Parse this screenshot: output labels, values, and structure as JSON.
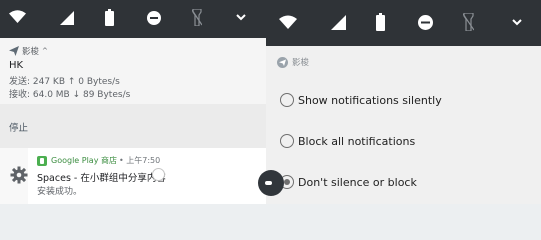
{
  "left_notification": {
    "app_name": "影梭",
    "expand_glyph": "^",
    "title": "HK",
    "send_line": "发送: 247 KB ↑ 0 Bytes/s",
    "recv_line": "接收: 64.0 MB ↓ 89 Bytes/s",
    "stop_action": "停止"
  },
  "play_notification": {
    "app_name": "Google Play 商店",
    "time": "• 上午7:50",
    "title": "Spaces - 在小群组中分享内容",
    "text": "安装成功。"
  },
  "right_panel": {
    "app_name": "影梭",
    "options": [
      {
        "label": "Show notifications silently",
        "selected": false
      },
      {
        "label": "Block all notifications",
        "selected": false
      },
      {
        "label": "Don't silence or block",
        "selected": true
      }
    ]
  },
  "icons": {
    "status_bar": [
      "wifi-icon",
      "signal-icon",
      "battery-icon",
      "dnd-icon",
      "flashlight-off-icon",
      "chevron-down-icon"
    ],
    "notification": "send-plane-icon",
    "settings": "gear-icon"
  },
  "colors": {
    "status_bar": "#2f3337",
    "play_green": "#3c8e41",
    "play_badge": "#4caf50"
  }
}
